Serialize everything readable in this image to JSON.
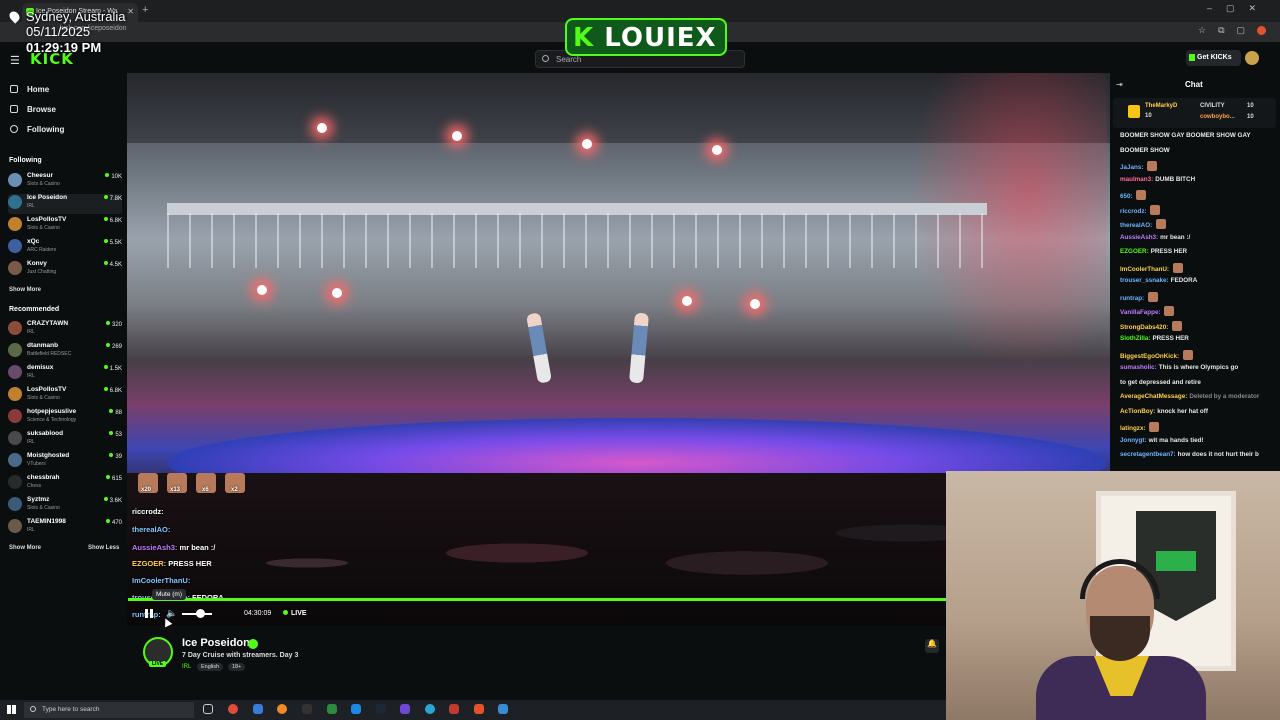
{
  "browser": {
    "tab_title": "Ice Poseidon Stream - Wa",
    "url": "kick.com/iceposeidon"
  },
  "overlay": {
    "location": "Sydney, Australia",
    "date": "05/11/2025",
    "time": "01:29:19 PM"
  },
  "brand_overlay": {
    "prefix": "K",
    "text": "LOUIEX"
  },
  "header": {
    "logo": "KICK",
    "search_placeholder": "Search",
    "get_kicks": "Get KICKs"
  },
  "nav": [
    {
      "label": "Home"
    },
    {
      "label": "Browse"
    },
    {
      "label": "Following"
    }
  ],
  "following_title": "Following",
  "following": [
    {
      "name": "Cheesur",
      "category": "Slots & Casino",
      "viewers": "10K",
      "color": "#6a8fb0"
    },
    {
      "name": "Ice Poseidon",
      "category": "IRL",
      "viewers": "7.8K",
      "color": "#2f6f8f"
    },
    {
      "name": "LosPollosTV",
      "category": "Slots & Casino",
      "viewers": "6.8K",
      "color": "#c0802e"
    },
    {
      "name": "xQc",
      "category": "ARC Raiders",
      "viewers": "5.5K",
      "color": "#3f5fa0"
    },
    {
      "name": "Konvy",
      "category": "Just Chatting",
      "viewers": "4.5K",
      "color": "#7a5a48"
    }
  ],
  "show_more": "Show More",
  "show_less": "Show Less",
  "recommended_title": "Recommended",
  "recommended": [
    {
      "name": "CRAZYTAWN",
      "category": "IRL",
      "viewers": "320",
      "color": "#8a4d3a"
    },
    {
      "name": "dtanmanb",
      "category": "Battlefield REDSEC",
      "viewers": "269",
      "color": "#5a6a48"
    },
    {
      "name": "demisux",
      "category": "IRL",
      "viewers": "1.5K",
      "color": "#6a4a6a"
    },
    {
      "name": "LosPollosTV",
      "category": "Slots & Casino",
      "viewers": "6.8K",
      "color": "#c0802e"
    },
    {
      "name": "hotpepjesuslive",
      "category": "Science & Technology",
      "viewers": "88",
      "color": "#8a3a3a"
    },
    {
      "name": "suksablood",
      "category": "IRL",
      "viewers": "53",
      "color": "#4a4a4a"
    },
    {
      "name": "Moistghosted",
      "category": "VTubers",
      "viewers": "39",
      "color": "#4a6a8a"
    },
    {
      "name": "chessbrah",
      "category": "Chess",
      "viewers": "615",
      "color": "#2a2a2a"
    },
    {
      "name": "Syztmz",
      "category": "Slots & Casino",
      "viewers": "3.6K",
      "color": "#3a5a7a"
    },
    {
      "name": "TAEMIN1998",
      "category": "IRL",
      "viewers": "470",
      "color": "#6a5a4a"
    }
  ],
  "video_overlay_chat": {
    "emote_counts": [
      "x20",
      "x13",
      "x6",
      "x2"
    ],
    "messages": [
      {
        "user": "riccrodz:",
        "text": ""
      },
      {
        "user": "therealAO:",
        "text": ""
      },
      {
        "user": "AussieAsh3:",
        "text": "mr bean :/"
      },
      {
        "user": "EZGOER:",
        "text": "PRESS HER"
      },
      {
        "user": "ImCoolerThanU:",
        "text": ""
      },
      {
        "user": "trouser_ssnake:",
        "text": "FEDORA"
      },
      {
        "user": "runtrap:",
        "text": ""
      }
    ]
  },
  "player": {
    "mute_tooltip": "Mute (m)",
    "elapsed": "04:30:09",
    "live_label": "LIVE",
    "progress": 1.0,
    "volume": 0.5
  },
  "stream": {
    "streamer": "Ice Poseidon",
    "title": "7 Day Cruise with streamers. Day 3",
    "category": "IRL",
    "tags": [
      "English",
      "18+"
    ],
    "live_badge": "LIVE"
  },
  "chat": {
    "title": "Chat",
    "pinned": [
      {
        "user": "TheMarkyD",
        "value": "10"
      },
      {
        "user": "CIVILITY",
        "value": "10"
      },
      {
        "user": "",
        "value": "10"
      },
      {
        "user": "cowboybo...",
        "value": "10"
      }
    ],
    "messages": [
      {
        "user": "",
        "text": "BOOMER SHOW GAY BOOMER SHOW GAY",
        "color": "#e8e8e8"
      },
      {
        "user": "",
        "text": "BOOMER SHOW",
        "color": "#e8e8e8"
      },
      {
        "user": "JaJans:",
        "text": "",
        "color": "#6fb4ff"
      },
      {
        "user": "maulman3:",
        "text": "DUMB BITCH",
        "color": "#ff6a9a"
      },
      {
        "user": "650:",
        "text": "",
        "color": "#6fb4ff"
      },
      {
        "user": "riccrodz:",
        "text": "",
        "color": "#6fb4ff"
      },
      {
        "user": "therealAO:",
        "text": "",
        "color": "#6fb4ff"
      },
      {
        "user": "AussieAsh3:",
        "text": "mr bean :/",
        "color": "#c07cff"
      },
      {
        "user": "EZGOER:",
        "text": "PRESS HER",
        "color": "#53fc18"
      },
      {
        "user": "ImCoolerThanU:",
        "text": "",
        "color": "#ffd04a"
      },
      {
        "user": "trouser_ssnake:",
        "text": "FEDORA",
        "color": "#6fb4ff"
      },
      {
        "user": "runtrap:",
        "text": "",
        "color": "#6fb4ff"
      },
      {
        "user": "VanillaFappe:",
        "text": "",
        "color": "#c07cff"
      },
      {
        "user": "StrongDabs420:",
        "text": "",
        "color": "#ffd04a"
      },
      {
        "user": "SlothZilla:",
        "text": "PRESS HER",
        "color": "#53fc18"
      },
      {
        "user": "BiggestEgoOnKick:",
        "text": "",
        "color": "#ffd04a"
      },
      {
        "user": "sumasholic:",
        "text": "This is where Olympics go",
        "color": "#c07cff"
      },
      {
        "user": "",
        "text": "to get depressed and retire",
        "color": "#e8e8e8"
      },
      {
        "user": "AverageChatMessage:",
        "text": "Deleted by a moderator",
        "color": "#ffd04a"
      },
      {
        "user": "AcTionBoy:",
        "text": "knock her hat off",
        "color": "#ffd04a"
      },
      {
        "user": "latingzx:",
        "text": "",
        "color": "#ffd04a"
      },
      {
        "user": "Jonnygt:",
        "text": "wit ma hands tied!",
        "color": "#6fb4ff"
      },
      {
        "user": "secretagentbean7:",
        "text": "how does it not hurt their b",
        "color": "#6fb4ff"
      }
    ]
  },
  "taskbar": {
    "search_placeholder": "Type here to search"
  }
}
